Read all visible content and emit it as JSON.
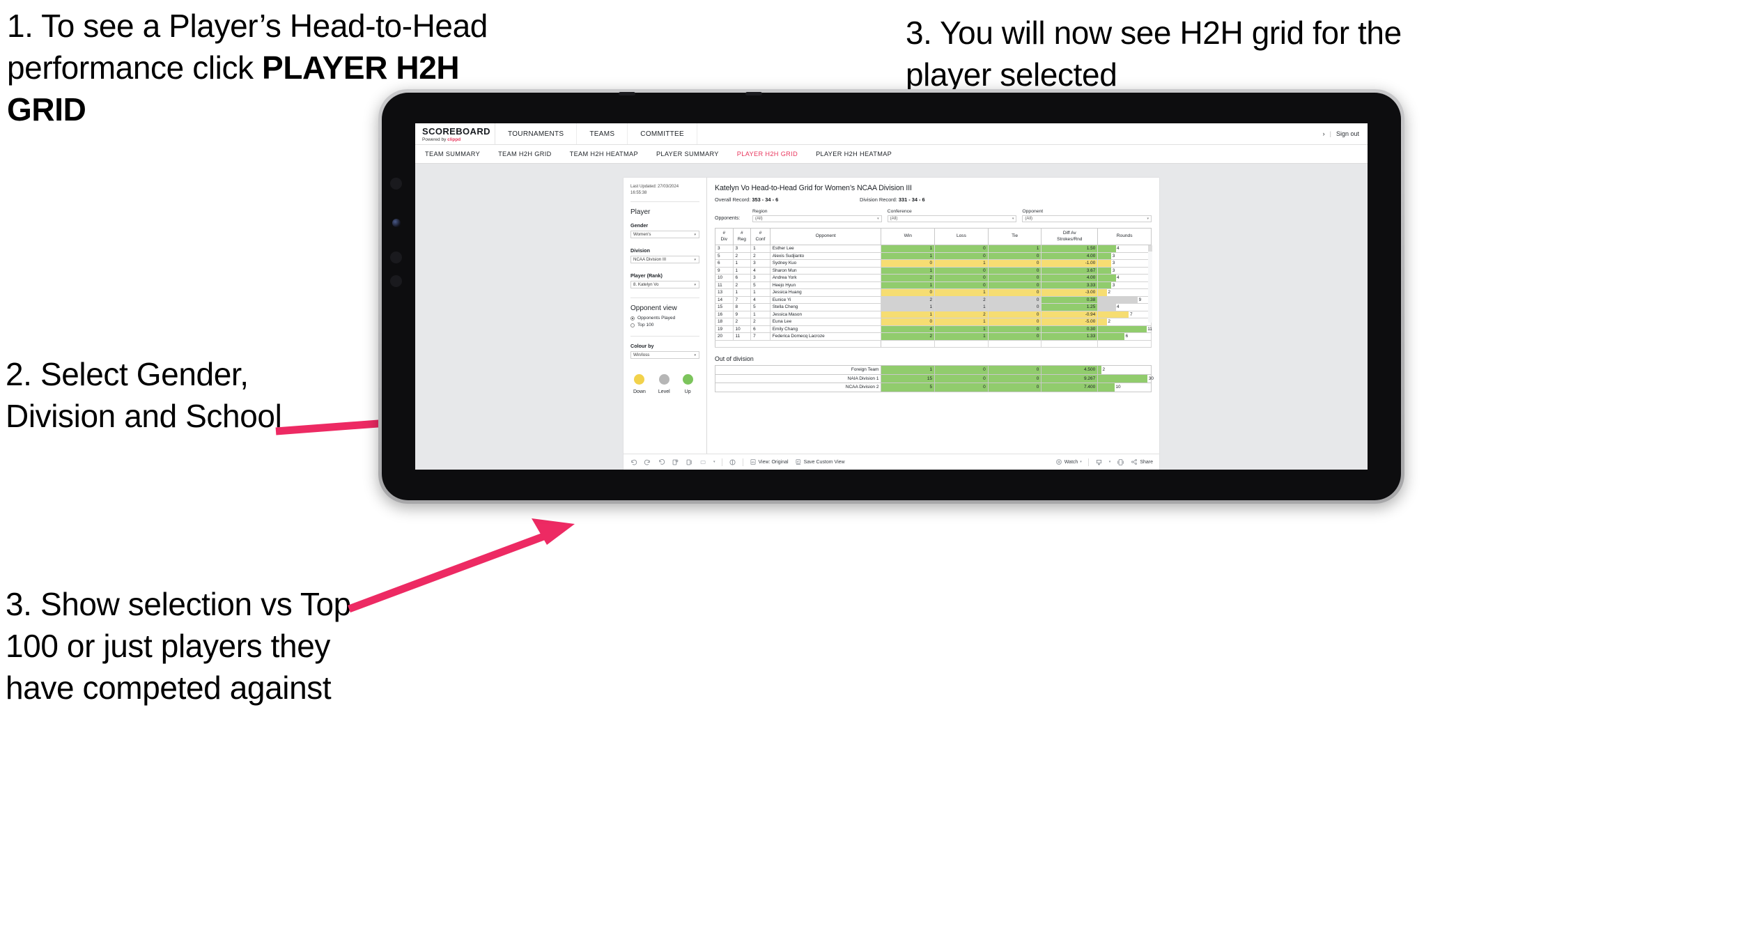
{
  "annotations": {
    "one_a": "1. To see a Player’s Head-to-Head performance click ",
    "one_b": "PLAYER H2H GRID",
    "two": "2. Select Gender, Division and School",
    "three": "3. Show selection vs Top 100 or just players they have competed against",
    "four": "3. You will now see H2H grid for the player selected",
    "accent": "#ED2A63"
  },
  "app": {
    "logo_main": "SCOREBOARD",
    "logo_sub_prefix": "Powered by ",
    "logo_sub_brand": "clippd",
    "top_nav": [
      "TOURNAMENTS",
      "TEAMS",
      "COMMITTEE"
    ],
    "user_glyph": "›",
    "separator": "|",
    "sign_out": "Sign out",
    "sub_nav": [
      {
        "label": "TEAM SUMMARY",
        "active": false
      },
      {
        "label": "TEAM H2H GRID",
        "active": false
      },
      {
        "label": "TEAM H2H HEATMAP",
        "active": false
      },
      {
        "label": "PLAYER SUMMARY",
        "active": false
      },
      {
        "label": "PLAYER H2H GRID",
        "active": true
      },
      {
        "label": "PLAYER H2H HEATMAP",
        "active": false
      }
    ]
  },
  "filters": {
    "last_updated_line1": "Last Updated: 27/03/2024",
    "last_updated_line2": "16:55:38",
    "player_heading": "Player",
    "gender_label": "Gender",
    "gender_value": "Women's",
    "division_label": "Division",
    "division_value": "NCAA Division III",
    "player_rank_label": "Player (Rank)",
    "player_rank_value": "8. Katelyn Vo",
    "opponent_view_heading": "Opponent view",
    "opponent_view_options": [
      {
        "label": "Opponents Played",
        "selected": true
      },
      {
        "label": "Top 100",
        "selected": false
      }
    ],
    "colour_by_label": "Colour by",
    "colour_by_value": "Win/loss",
    "legend": [
      {
        "label": "Down",
        "color": "#F2D24B"
      },
      {
        "label": "Level",
        "color": "#B6B6B6"
      },
      {
        "label": "Up",
        "color": "#7CC45C"
      }
    ]
  },
  "viz": {
    "title": "Katelyn Vo Head-to-Head Grid for Women’s NCAA Division III",
    "overall_record_label": "Overall Record: ",
    "overall_record_value": "353 - 34 - 6",
    "division_record_label": "Division Record: ",
    "division_record_value": "331 - 34 - 6",
    "opponents_label": "Opponents:",
    "opponent_filters": [
      {
        "label": "Region",
        "value": "(All)"
      },
      {
        "label": "Conference",
        "value": "(All)"
      },
      {
        "label": "Opponent",
        "value": "(All)"
      }
    ],
    "out_of_division_title": "Out of division"
  },
  "chart_data": {
    "type": "table",
    "title": "Katelyn Vo Head-to-Head Grid for Women’s NCAA Division III",
    "columns": [
      "# Div",
      "# Reg",
      "# Conf",
      "Opponent",
      "Win",
      "Loss",
      "Tie",
      "Diff Av Strokes/Rnd",
      "Rounds"
    ],
    "column_header_lines": [
      [
        "#",
        "Div"
      ],
      [
        "#",
        "Reg"
      ],
      [
        "#",
        "Conf"
      ],
      [
        "Opponent"
      ],
      [
        "Win"
      ],
      [
        "Loss"
      ],
      [
        "Tie"
      ],
      [
        "Diff Av",
        "Strokes/Rnd"
      ],
      [
        "Rounds"
      ]
    ],
    "rounds_max": 12,
    "rows": [
      {
        "div": "3",
        "reg": "3",
        "conf": "1",
        "opponent": "Esther Lee",
        "win": "1",
        "loss": "0",
        "tie": "1",
        "diff": "1.50",
        "rounds": "4",
        "state": "up"
      },
      {
        "div": "5",
        "reg": "2",
        "conf": "2",
        "opponent": "Alexis Sudjianto",
        "win": "1",
        "loss": "0",
        "tie": "0",
        "diff": "4.00",
        "rounds": "3",
        "state": "up"
      },
      {
        "div": "6",
        "reg": "1",
        "conf": "3",
        "opponent": "Sydney Kuo",
        "win": "0",
        "loss": "1",
        "tie": "0",
        "diff": "-1.00",
        "rounds": "3",
        "state": "down"
      },
      {
        "div": "9",
        "reg": "1",
        "conf": "4",
        "opponent": "Sharon Mun",
        "win": "1",
        "loss": "0",
        "tie": "0",
        "diff": "3.67",
        "rounds": "3",
        "state": "up"
      },
      {
        "div": "10",
        "reg": "6",
        "conf": "3",
        "opponent": "Andrea York",
        "win": "2",
        "loss": "0",
        "tie": "0",
        "diff": "4.00",
        "rounds": "4",
        "state": "up"
      },
      {
        "div": "11",
        "reg": "2",
        "conf": "5",
        "opponent": "Heejo Hyun",
        "win": "1",
        "loss": "0",
        "tie": "0",
        "diff": "3.33",
        "rounds": "3",
        "state": "up"
      },
      {
        "div": "13",
        "reg": "1",
        "conf": "1",
        "opponent": "Jessica Huang",
        "win": "0",
        "loss": "1",
        "tie": "0",
        "diff": "-3.00",
        "rounds": "2",
        "state": "down"
      },
      {
        "div": "14",
        "reg": "7",
        "conf": "4",
        "opponent": "Eunice Yi",
        "win": "2",
        "loss": "2",
        "tie": "0",
        "diff": "0.38",
        "rounds": "9",
        "state": "level",
        "diff_state": "up"
      },
      {
        "div": "15",
        "reg": "8",
        "conf": "5",
        "opponent": "Stella Cheng",
        "win": "1",
        "loss": "1",
        "tie": "0",
        "diff": "1.25",
        "rounds": "4",
        "state": "level",
        "diff_state": "up"
      },
      {
        "div": "16",
        "reg": "9",
        "conf": "1",
        "opponent": "Jessica Mason",
        "win": "1",
        "loss": "2",
        "tie": "0",
        "diff": "-0.94",
        "rounds": "7",
        "state": "down"
      },
      {
        "div": "18",
        "reg": "2",
        "conf": "2",
        "opponent": "Euna Lee",
        "win": "0",
        "loss": "1",
        "tie": "0",
        "diff": "-5.00",
        "rounds": "2",
        "state": "down"
      },
      {
        "div": "19",
        "reg": "10",
        "conf": "6",
        "opponent": "Emily Chang",
        "win": "4",
        "loss": "1",
        "tie": "0",
        "diff": "0.30",
        "rounds": "11",
        "state": "up"
      },
      {
        "div": "20",
        "reg": "11",
        "conf": "7",
        "opponent": "Federica Domecq Lacroze",
        "win": "2",
        "loss": "1",
        "tie": "0",
        "diff": "1.33",
        "rounds": "6",
        "state": "up"
      }
    ],
    "out_of_division_rows": [
      {
        "opponent": "Foreign Team",
        "win": "1",
        "loss": "0",
        "tie": "0",
        "diff": "4.500",
        "rounds": "2",
        "state": "up"
      },
      {
        "opponent": "NAIA Division 1",
        "win": "15",
        "loss": "0",
        "tie": "0",
        "diff": "9.267",
        "rounds": "30",
        "state": "up"
      },
      {
        "opponent": "NCAA Division 2",
        "win": "5",
        "loss": "0",
        "tie": "0",
        "diff": "7.400",
        "rounds": "10",
        "state": "up"
      }
    ],
    "out_of_division_rounds_max": 32,
    "colors": {
      "up": "#91CC6D",
      "down": "#F6DD72",
      "level": "#D2D2D2"
    }
  },
  "toolbar": {
    "view_label": "View: Original",
    "save_label": "Save Custom View",
    "watch_label": "Watch",
    "share_label": "Share"
  }
}
